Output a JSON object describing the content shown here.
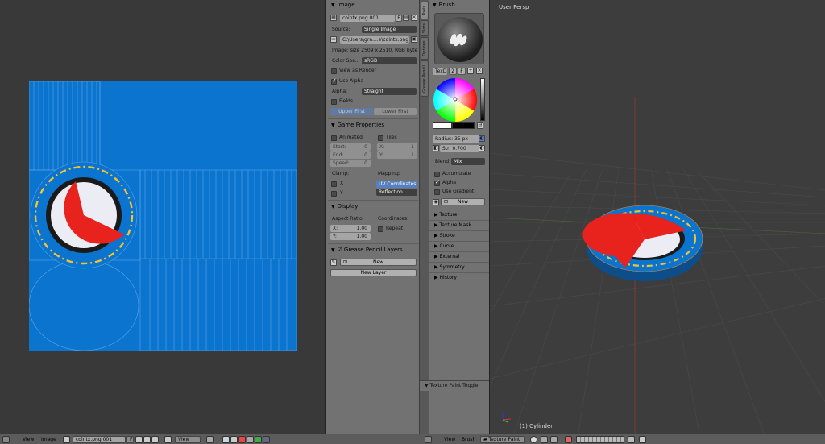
{
  "image_panel": {
    "header": "Image",
    "image_name": "cointx.png.001",
    "fake_btn": "F",
    "source_label": "Source:",
    "source_value": "Single Image",
    "filepath": "C:\\Users\\gra....e\\cointx.png",
    "image_info": "Image: size 2509 x 2510, RGB byte",
    "colorspace_label": "Color Spa...",
    "colorspace_value": "sRGB",
    "view_as_render": "View as Render",
    "use_alpha": "Use Alpha",
    "alpha_label": "Alpha:",
    "alpha_value": "Straight",
    "fields": "Fields",
    "upper_first": "Upper First",
    "lower_first": "Lower First",
    "game_props_header": "Game Properties",
    "animated": "Animated",
    "tiles": "Tiles",
    "start_label": "Start:",
    "start_val": "0",
    "end_label": "End:",
    "end_val": "0",
    "speed_label": "Speed:",
    "speed_val": "0",
    "x_label": "X:",
    "x_val": "1",
    "y_label": "Y:",
    "y_val": "1",
    "clamp_label": "Clamp:",
    "mapping_label": "Mapping:",
    "clamp_x": "X",
    "clamp_y": "Y",
    "uv_coords": "UV Coordinates",
    "reflection": "Reflection",
    "display_header": "Display",
    "aspect_label": "Aspect Ratio:",
    "coords_label": "Coordinates:",
    "aspect_x_label": "X:",
    "aspect_x_val": "1.00",
    "aspect_y_label": "Y:",
    "aspect_y_val": "1.00",
    "repeat": "Repeat",
    "gp_layers_header": "Grease Pencil Layers",
    "gp_new": "New",
    "new_layer": "New Layer"
  },
  "tabs": [
    "Tools",
    "Slots",
    "Options",
    "Grease Pencil"
  ],
  "tools_panel": {
    "brush_header": "Brush",
    "brush_name": "TexDr",
    "users": "2",
    "fake": "F",
    "radius_label": "Radius:",
    "radius_val": "35 px",
    "strength_label": "Str:",
    "strength_val": "0.700",
    "blend_label": "Blend:",
    "blend_val": "Mix",
    "accumulate": "Accumulate",
    "alpha": "Alpha",
    "use_gradient": "Use Gradient",
    "palette_new": "New",
    "sections": [
      "Texture",
      "Texture Mask",
      "Stroke",
      "Curve",
      "External",
      "Symmetry",
      "History"
    ],
    "texture_paint_toggle": "Texture Paint Toggle"
  },
  "viewport": {
    "label": "User Persp",
    "object": "(1) Cylinder"
  },
  "header_left": {
    "view": "View",
    "image": "Image",
    "image_name": "cointx.png.001",
    "fake": "F",
    "view2": "View"
  },
  "header_right": {
    "view": "View",
    "brush": "Brush",
    "mode": "Texture Paint"
  },
  "colors": {
    "uv_blue": "#0a74cf",
    "coin_red": "#e8221c",
    "coin_yellow": "#f2c232",
    "coin_white": "#ececf4",
    "coin_black": "#1a1a1a",
    "selection_blue": "#5680c2"
  }
}
